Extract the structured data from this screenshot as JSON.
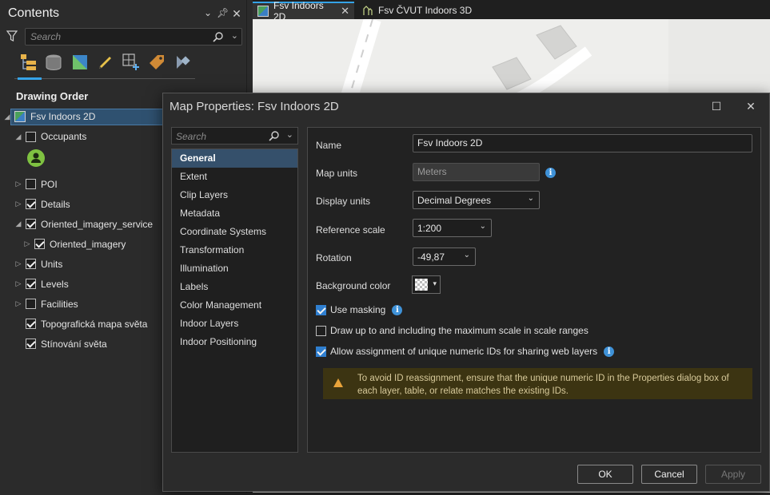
{
  "contents": {
    "title": "Contents",
    "search_placeholder": "Search",
    "drawing_order": "Drawing Order",
    "layers": [
      {
        "label": "Fsv Indoors 2D"
      },
      {
        "label": "Occupants",
        "checked": false
      },
      {
        "label": "POI",
        "checked": false
      },
      {
        "label": "Details",
        "checked": true
      },
      {
        "label": "Oriented_imagery_service",
        "checked": true
      },
      {
        "label": "Oriented_imagery",
        "checked": true
      },
      {
        "label": "Units",
        "checked": true
      },
      {
        "label": "Levels",
        "checked": true
      },
      {
        "label": "Facilities",
        "checked": false
      },
      {
        "label": "Topografická mapa světa",
        "checked": true
      },
      {
        "label": "Stínování světa",
        "checked": true
      }
    ]
  },
  "tabs": [
    {
      "label": "Fsv Indoors 2D",
      "active": true
    },
    {
      "label": "Fsv ČVUT Indoors 3D",
      "active": false
    }
  ],
  "dialog": {
    "title": "Map Properties: Fsv Indoors 2D",
    "search_placeholder": "Search",
    "nav": [
      "General",
      "Extent",
      "Clip Layers",
      "Metadata",
      "Coordinate Systems",
      "Transformation",
      "Illumination",
      "Labels",
      "Color Management",
      "Indoor Layers",
      "Indoor Positioning"
    ],
    "selected_nav": "General",
    "fields": {
      "name_label": "Name",
      "name_value": "Fsv Indoors 2D",
      "map_units_label": "Map units",
      "map_units_value": "Meters",
      "display_units_label": "Display units",
      "display_units_value": "Decimal Degrees",
      "reference_scale_label": "Reference scale",
      "reference_scale_value": "1:200",
      "rotation_label": "Rotation",
      "rotation_value": "-49,87",
      "background_color_label": "Background color"
    },
    "checks": [
      {
        "label": "Use masking",
        "checked": true
      },
      {
        "label": "Draw up to and including the maximum scale in scale ranges",
        "checked": false
      },
      {
        "label": "Allow assignment of unique numeric IDs for sharing web layers",
        "checked": true
      }
    ],
    "warning": "To avoid ID reassignment, ensure that the unique numeric ID in the Properties dialog box of each layer, table, or relate matches the existing IDs.",
    "buttons": {
      "ok": "OK",
      "cancel": "Cancel",
      "apply": "Apply"
    }
  },
  "colors": {
    "accent": "#35a3e8",
    "selection": "#35506b",
    "warning_bg": "#3c3412",
    "warning_icon": "#e8a33a"
  }
}
